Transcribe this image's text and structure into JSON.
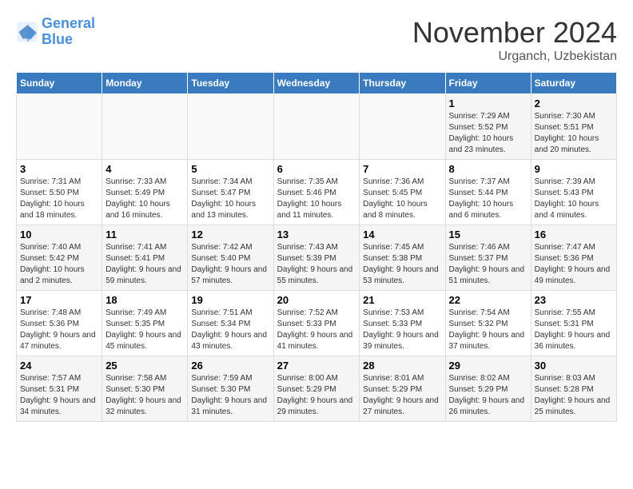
{
  "logo": {
    "text_general": "General",
    "text_blue": "Blue"
  },
  "header": {
    "month": "November 2024",
    "location": "Urganch, Uzbekistan"
  },
  "weekdays": [
    "Sunday",
    "Monday",
    "Tuesday",
    "Wednesday",
    "Thursday",
    "Friday",
    "Saturday"
  ],
  "weeks": [
    [
      {
        "day": "",
        "info": ""
      },
      {
        "day": "",
        "info": ""
      },
      {
        "day": "",
        "info": ""
      },
      {
        "day": "",
        "info": ""
      },
      {
        "day": "",
        "info": ""
      },
      {
        "day": "1",
        "info": "Sunrise: 7:29 AM\nSunset: 5:52 PM\nDaylight: 10 hours and 23 minutes."
      },
      {
        "day": "2",
        "info": "Sunrise: 7:30 AM\nSunset: 5:51 PM\nDaylight: 10 hours and 20 minutes."
      }
    ],
    [
      {
        "day": "3",
        "info": "Sunrise: 7:31 AM\nSunset: 5:50 PM\nDaylight: 10 hours and 18 minutes."
      },
      {
        "day": "4",
        "info": "Sunrise: 7:33 AM\nSunset: 5:49 PM\nDaylight: 10 hours and 16 minutes."
      },
      {
        "day": "5",
        "info": "Sunrise: 7:34 AM\nSunset: 5:47 PM\nDaylight: 10 hours and 13 minutes."
      },
      {
        "day": "6",
        "info": "Sunrise: 7:35 AM\nSunset: 5:46 PM\nDaylight: 10 hours and 11 minutes."
      },
      {
        "day": "7",
        "info": "Sunrise: 7:36 AM\nSunset: 5:45 PM\nDaylight: 10 hours and 8 minutes."
      },
      {
        "day": "8",
        "info": "Sunrise: 7:37 AM\nSunset: 5:44 PM\nDaylight: 10 hours and 6 minutes."
      },
      {
        "day": "9",
        "info": "Sunrise: 7:39 AM\nSunset: 5:43 PM\nDaylight: 10 hours and 4 minutes."
      }
    ],
    [
      {
        "day": "10",
        "info": "Sunrise: 7:40 AM\nSunset: 5:42 PM\nDaylight: 10 hours and 2 minutes."
      },
      {
        "day": "11",
        "info": "Sunrise: 7:41 AM\nSunset: 5:41 PM\nDaylight: 9 hours and 59 minutes."
      },
      {
        "day": "12",
        "info": "Sunrise: 7:42 AM\nSunset: 5:40 PM\nDaylight: 9 hours and 57 minutes."
      },
      {
        "day": "13",
        "info": "Sunrise: 7:43 AM\nSunset: 5:39 PM\nDaylight: 9 hours and 55 minutes."
      },
      {
        "day": "14",
        "info": "Sunrise: 7:45 AM\nSunset: 5:38 PM\nDaylight: 9 hours and 53 minutes."
      },
      {
        "day": "15",
        "info": "Sunrise: 7:46 AM\nSunset: 5:37 PM\nDaylight: 9 hours and 51 minutes."
      },
      {
        "day": "16",
        "info": "Sunrise: 7:47 AM\nSunset: 5:36 PM\nDaylight: 9 hours and 49 minutes."
      }
    ],
    [
      {
        "day": "17",
        "info": "Sunrise: 7:48 AM\nSunset: 5:36 PM\nDaylight: 9 hours and 47 minutes."
      },
      {
        "day": "18",
        "info": "Sunrise: 7:49 AM\nSunset: 5:35 PM\nDaylight: 9 hours and 45 minutes."
      },
      {
        "day": "19",
        "info": "Sunrise: 7:51 AM\nSunset: 5:34 PM\nDaylight: 9 hours and 43 minutes."
      },
      {
        "day": "20",
        "info": "Sunrise: 7:52 AM\nSunset: 5:33 PM\nDaylight: 9 hours and 41 minutes."
      },
      {
        "day": "21",
        "info": "Sunrise: 7:53 AM\nSunset: 5:33 PM\nDaylight: 9 hours and 39 minutes."
      },
      {
        "day": "22",
        "info": "Sunrise: 7:54 AM\nSunset: 5:32 PM\nDaylight: 9 hours and 37 minutes."
      },
      {
        "day": "23",
        "info": "Sunrise: 7:55 AM\nSunset: 5:31 PM\nDaylight: 9 hours and 36 minutes."
      }
    ],
    [
      {
        "day": "24",
        "info": "Sunrise: 7:57 AM\nSunset: 5:31 PM\nDaylight: 9 hours and 34 minutes."
      },
      {
        "day": "25",
        "info": "Sunrise: 7:58 AM\nSunset: 5:30 PM\nDaylight: 9 hours and 32 minutes."
      },
      {
        "day": "26",
        "info": "Sunrise: 7:59 AM\nSunset: 5:30 PM\nDaylight: 9 hours and 31 minutes."
      },
      {
        "day": "27",
        "info": "Sunrise: 8:00 AM\nSunset: 5:29 PM\nDaylight: 9 hours and 29 minutes."
      },
      {
        "day": "28",
        "info": "Sunrise: 8:01 AM\nSunset: 5:29 PM\nDaylight: 9 hours and 27 minutes."
      },
      {
        "day": "29",
        "info": "Sunrise: 8:02 AM\nSunset: 5:29 PM\nDaylight: 9 hours and 26 minutes."
      },
      {
        "day": "30",
        "info": "Sunrise: 8:03 AM\nSunset: 5:28 PM\nDaylight: 9 hours and 25 minutes."
      }
    ]
  ]
}
